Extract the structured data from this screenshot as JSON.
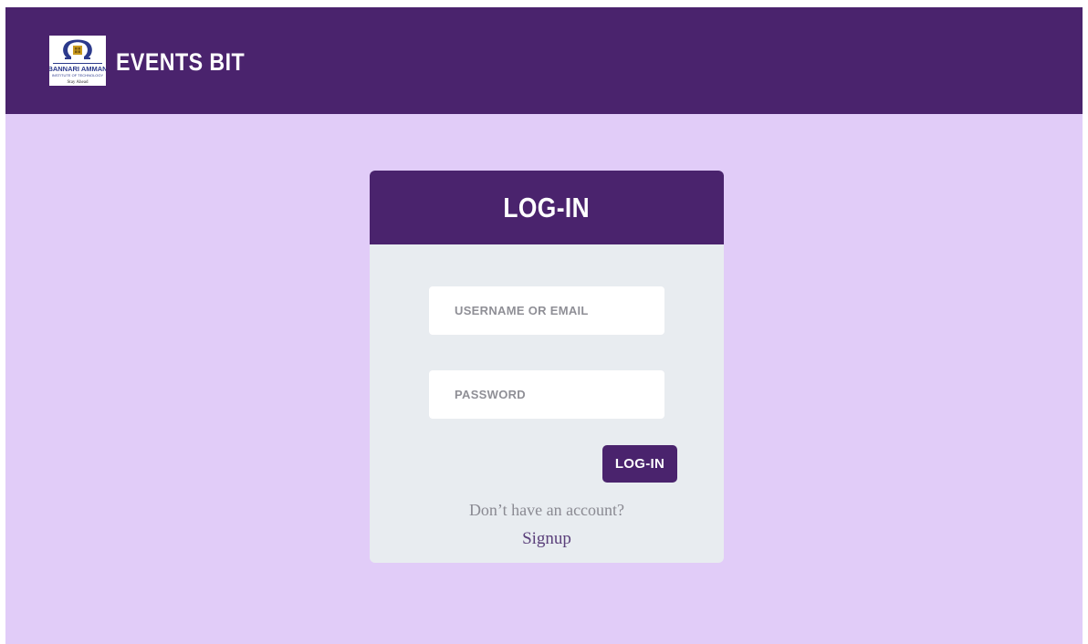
{
  "navbar": {
    "brand": "EVENTS BIT",
    "logo_icon": "institute-logo",
    "logo_text_line1": "BANNARI AMMAN",
    "logo_text_line2": "INSTITUTE OF TECHNOLOGY",
    "logo_motto": "Stay Ahead"
  },
  "login_card": {
    "title": "LOG-IN",
    "username_placeholder": "USERNAME OR EMAIL",
    "username_value": "",
    "password_placeholder": "PASSWORD",
    "password_value": "",
    "submit_label": "LOG-IN",
    "no_account_text": "Don’t have an account?",
    "signup_label": "Signup"
  },
  "colors": {
    "primary": "#4a236d",
    "background": "#e1ccf8",
    "card": "#e8ecf0"
  }
}
